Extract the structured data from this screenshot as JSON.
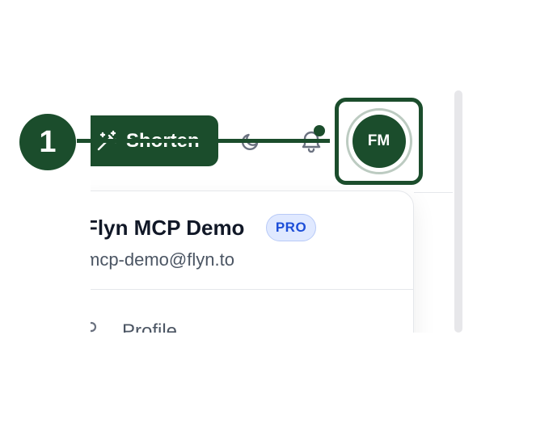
{
  "colors": {
    "brand": "#1b4d2c",
    "pro_badge_bg": "#e0e9ff",
    "pro_badge_text": "#1d4ed8"
  },
  "header": {
    "shorten_button": {
      "label": "Shorten",
      "icon": "magic-wand-icon"
    },
    "theme_toggle": {
      "icon": "moon-icon"
    },
    "notifications": {
      "icon": "bell-icon",
      "has_unread": true
    },
    "avatar": {
      "initials": "FM"
    }
  },
  "user_menu": {
    "name": "Flyn MCP Demo",
    "badge": "PRO",
    "email": "mcp-demo@flyn.to",
    "items": [
      {
        "label": "Profile",
        "icon": "user-icon"
      }
    ]
  },
  "annotation": {
    "step_number": "1"
  }
}
